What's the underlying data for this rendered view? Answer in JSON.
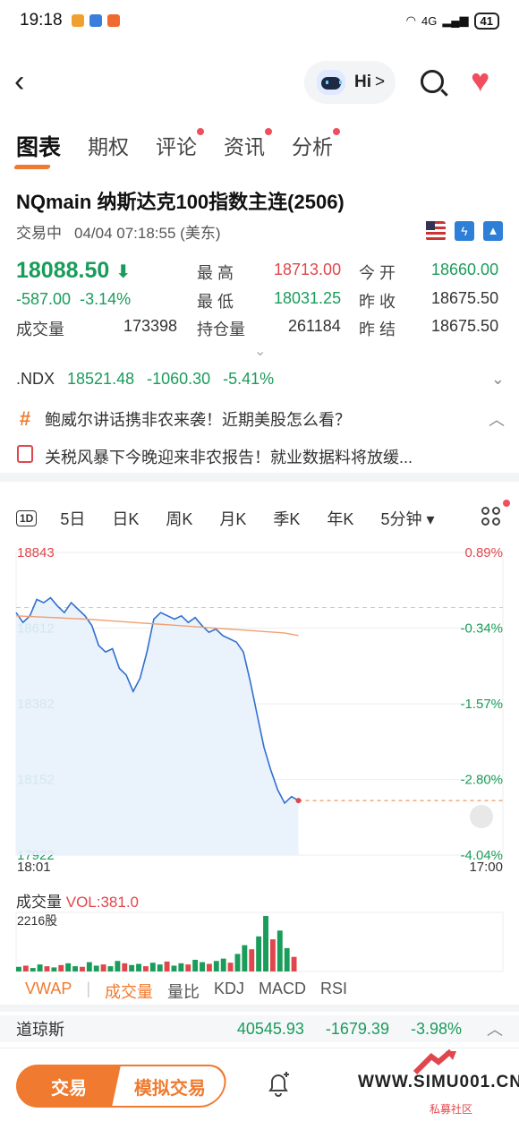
{
  "status_bar": {
    "time": "19:18",
    "network": "4G",
    "battery": "41"
  },
  "header": {
    "assistant_label": "Hi",
    "assistant_chevron": ">"
  },
  "tabs": [
    {
      "label": "图表",
      "active": true,
      "dot": false
    },
    {
      "label": "期权",
      "active": false,
      "dot": false
    },
    {
      "label": "评论",
      "active": false,
      "dot": true
    },
    {
      "label": "资讯",
      "active": false,
      "dot": true
    },
    {
      "label": "分析",
      "active": false,
      "dot": true
    }
  ],
  "instrument": {
    "title": "NQmain  纳斯达克100指数主连(2506)",
    "status": "交易中",
    "datetime": "04/04 07:18:55 (美东)"
  },
  "quote": {
    "last": "18088.50",
    "change": "-587.00",
    "change_pct": "-3.14%",
    "high_label": "最 高",
    "high": "18713.00",
    "open_label": "今 开",
    "open": "18660.00",
    "low_label": "最 低",
    "low": "18031.25",
    "prev_close_label": "昨 收",
    "prev_close": "18675.50",
    "volume_label": "成交量",
    "volume": "173398",
    "oi_label": "持仓量",
    "oi": "261184",
    "prev_settle_label": "昨 结",
    "prev_settle": "18675.50"
  },
  "ndx": {
    "label": ".NDX",
    "value": "18521.48",
    "change": "-1060.30",
    "change_pct": "-5.41%"
  },
  "news": [
    {
      "icon": "#",
      "text": "鲍威尔讲话携非农来袭！近期美股怎么看？"
    },
    {
      "icon": "doc",
      "text": "关税风暴下今晚迎来非农报告！就业数据料将放缓..."
    }
  ],
  "periods": [
    "1D",
    "5日",
    "日K",
    "周K",
    "月K",
    "季K",
    "年K",
    "5分钟 ▾"
  ],
  "chart_data": {
    "type": "line",
    "y_left_ticks": [
      "18843",
      "18612",
      "18382",
      "18152",
      "17922"
    ],
    "y_right_ticks": [
      "0.89%",
      "-0.34%",
      "-1.57%",
      "-2.80%",
      "-4.04%"
    ],
    "x_ticks": [
      "18:01",
      "17:00"
    ],
    "ylim": [
      17922,
      18843
    ],
    "prev_close": 18675.5,
    "series": [
      {
        "values": [
          18660,
          18630,
          18650,
          18700,
          18690,
          18705,
          18680,
          18660,
          18690,
          18670,
          18650,
          18620,
          18560,
          18540,
          18550,
          18490,
          18470,
          18420,
          18460,
          18540,
          18640,
          18660,
          18650,
          18640,
          18650,
          18630,
          18645,
          18620,
          18600,
          18610,
          18590,
          18580,
          18570,
          18540,
          18450,
          18350,
          18250,
          18180,
          18120,
          18080,
          18100,
          18088
        ]
      },
      {
        "values": [
          18650,
          18648,
          18646,
          18644,
          18642,
          18640,
          18637,
          18634,
          18631,
          18628,
          18625,
          18622,
          18619,
          18616,
          18613,
          18610,
          18607,
          18604,
          18601,
          18598,
          18590
        ]
      }
    ]
  },
  "volume": {
    "label": "成交量",
    "indicator": "VOL:381.0",
    "axis_label": "2216股",
    "bars": [
      {
        "v": 8,
        "c": "g"
      },
      {
        "v": 10,
        "c": "r"
      },
      {
        "v": 6,
        "c": "g"
      },
      {
        "v": 12,
        "c": "g"
      },
      {
        "v": 9,
        "c": "r"
      },
      {
        "v": 7,
        "c": "g"
      },
      {
        "v": 11,
        "c": "r"
      },
      {
        "v": 14,
        "c": "g"
      },
      {
        "v": 9,
        "c": "g"
      },
      {
        "v": 8,
        "c": "r"
      },
      {
        "v": 16,
        "c": "g"
      },
      {
        "v": 10,
        "c": "g"
      },
      {
        "v": 12,
        "c": "r"
      },
      {
        "v": 9,
        "c": "g"
      },
      {
        "v": 18,
        "c": "g"
      },
      {
        "v": 14,
        "c": "r"
      },
      {
        "v": 11,
        "c": "g"
      },
      {
        "v": 13,
        "c": "g"
      },
      {
        "v": 9,
        "c": "r"
      },
      {
        "v": 15,
        "c": "g"
      },
      {
        "v": 12,
        "c": "g"
      },
      {
        "v": 17,
        "c": "r"
      },
      {
        "v": 10,
        "c": "g"
      },
      {
        "v": 14,
        "c": "g"
      },
      {
        "v": 12,
        "c": "r"
      },
      {
        "v": 20,
        "c": "g"
      },
      {
        "v": 16,
        "c": "g"
      },
      {
        "v": 13,
        "c": "r"
      },
      {
        "v": 18,
        "c": "g"
      },
      {
        "v": 22,
        "c": "g"
      },
      {
        "v": 15,
        "c": "r"
      },
      {
        "v": 30,
        "c": "g"
      },
      {
        "v": 45,
        "c": "g"
      },
      {
        "v": 38,
        "c": "r"
      },
      {
        "v": 60,
        "c": "g"
      },
      {
        "v": 95,
        "c": "g"
      },
      {
        "v": 55,
        "c": "r"
      },
      {
        "v": 70,
        "c": "g"
      },
      {
        "v": 40,
        "c": "g"
      },
      {
        "v": 25,
        "c": "r"
      }
    ]
  },
  "indicators": [
    "VWAP",
    "成交量",
    "量比",
    "KDJ",
    "MACD",
    "RSI"
  ],
  "active_indicator": "成交量",
  "dow": {
    "name": "道琼斯",
    "value": "40545.93",
    "change": "-1679.39",
    "change_pct": "-3.98%"
  },
  "bottom": {
    "trade": "交易",
    "sim_trade": "模拟交易"
  },
  "watermark": {
    "text": "WWW.SIMU001.CN",
    "sub": "私募社区"
  },
  "colors": {
    "down": "#1a9c5b",
    "up": "#e0474c",
    "accent": "#f07a2f"
  }
}
